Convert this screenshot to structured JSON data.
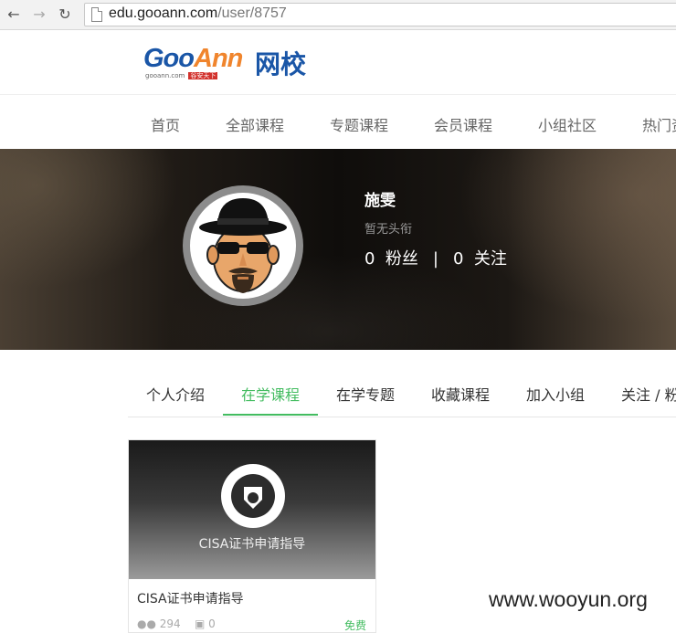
{
  "browser": {
    "url_host": "edu.gooann.com",
    "url_path": "/user/8757"
  },
  "logo": {
    "part1": "Goo",
    "part2": "Ann",
    "cn": "网校",
    "domain": "gooann.com",
    "tagline": "谷安天下"
  },
  "main_nav": [
    "首页",
    "全部课程",
    "专题课程",
    "会员课程",
    "小组社区",
    "热门资"
  ],
  "profile": {
    "name": "施雯",
    "title": "暂无头衔",
    "fans_count": "0",
    "fans_label": "粉丝",
    "follow_count": "0",
    "follow_label": "关注",
    "separator": "|"
  },
  "tabs": [
    {
      "label": "个人介绍",
      "active": false
    },
    {
      "label": "在学课程",
      "active": true
    },
    {
      "label": "在学专题",
      "active": false
    },
    {
      "label": "收藏课程",
      "active": false
    },
    {
      "label": "加入小组",
      "active": false
    },
    {
      "label": "关注 / 粉",
      "active": false
    }
  ],
  "course_card": {
    "image_text": "CISA证书申请指导",
    "title": "CISA证书申请指导",
    "students": "294",
    "comments": "0",
    "price": "免费"
  },
  "watermark": "www.wooyun.org",
  "colors": {
    "accent": "#43bc60",
    "logo_blue": "#1a56a7",
    "logo_orange": "#f0852d"
  }
}
